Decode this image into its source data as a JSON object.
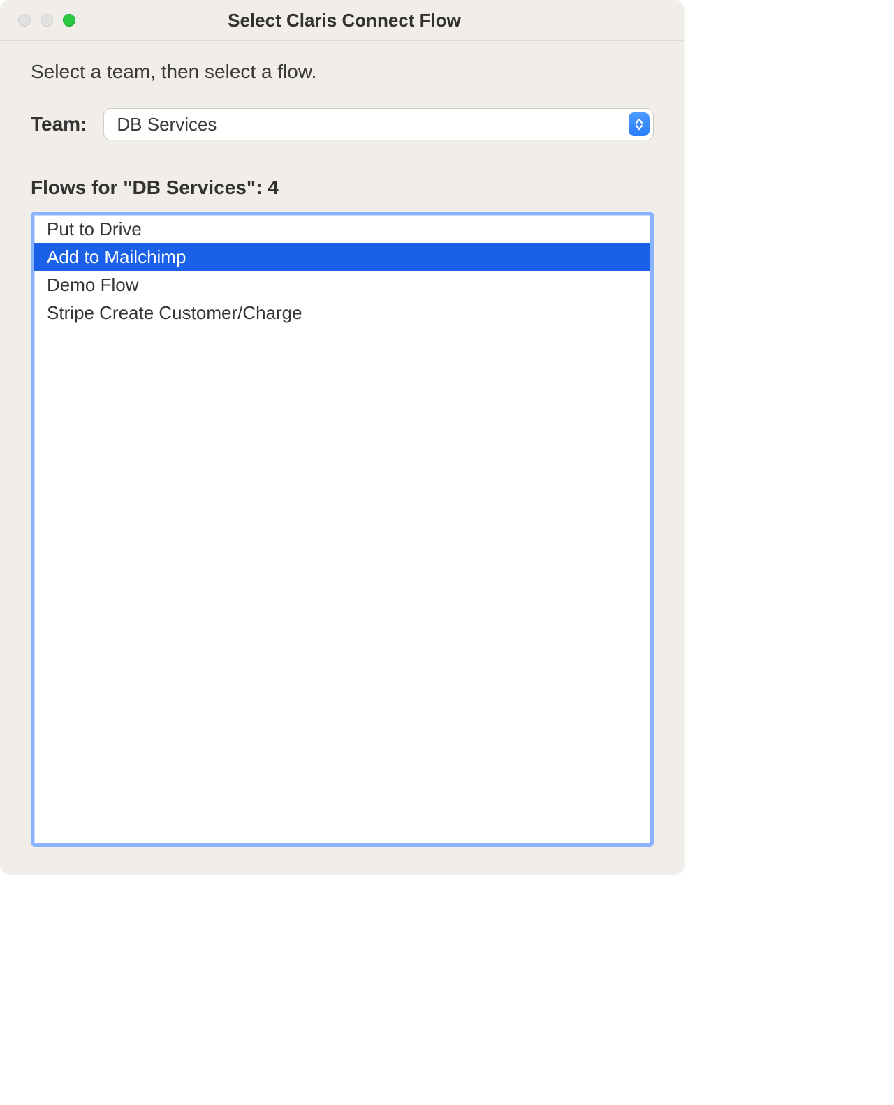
{
  "window": {
    "title": "Select Claris Connect Flow"
  },
  "instruction": "Select a team, then select a flow.",
  "team": {
    "label": "Team:",
    "selected": "DB Services"
  },
  "flows": {
    "heading": "Flows for \"DB Services\": 4",
    "items": [
      {
        "label": "Put to Drive",
        "selected": false
      },
      {
        "label": "Add to Mailchimp",
        "selected": true
      },
      {
        "label": "Demo Flow",
        "selected": false
      },
      {
        "label": "Stripe Create Customer/Charge",
        "selected": false
      }
    ]
  }
}
